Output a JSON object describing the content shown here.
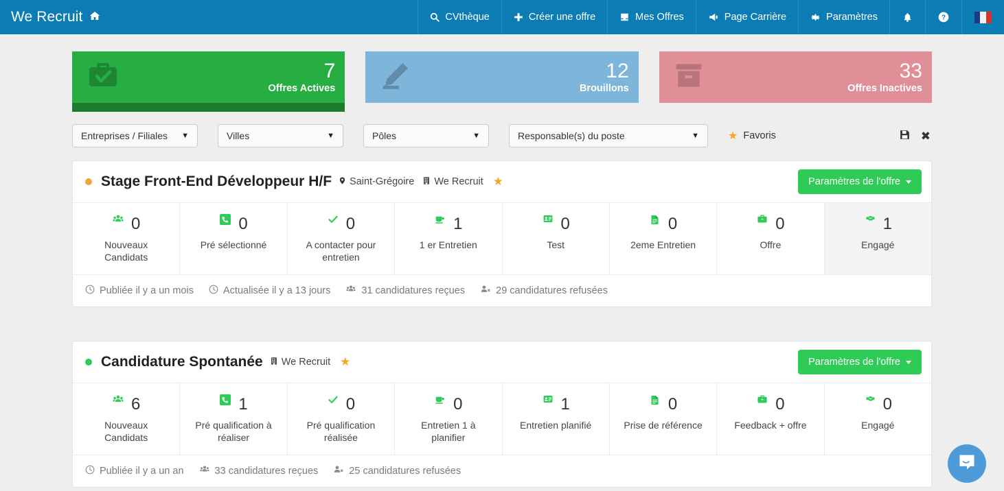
{
  "navbar": {
    "brand": "We Recruit",
    "brand_icon": "home-icon",
    "items": [
      {
        "label": "CVthèque",
        "icon": "search-icon"
      },
      {
        "label": "Créer une offre",
        "icon": "plus-icon"
      },
      {
        "label": "Mes Offres",
        "icon": "inbox-icon"
      },
      {
        "label": "Page Carrière",
        "icon": "bullhorn-icon"
      },
      {
        "label": "Paramètres",
        "icon": "gear-icon"
      }
    ],
    "notifications_icon": "bell-icon",
    "help_icon": "question-circle-icon",
    "language_icon": "french-flag-icon",
    "background": "#0c7cb5"
  },
  "stat_cards": [
    {
      "value": "7",
      "label": "Offres Actives",
      "icon": "briefcase-check-icon",
      "color": "#27ae43"
    },
    {
      "value": "12",
      "label": "Brouillons",
      "icon": "pencil-icon",
      "color": "#7eb5db"
    },
    {
      "value": "33",
      "label": "Offres Inactives",
      "icon": "archive-icon",
      "color": "#e08f96"
    }
  ],
  "filters": {
    "selects": [
      {
        "label": "Entreprises / Filiales",
        "width": "sel-w1"
      },
      {
        "label": "Villes",
        "width": "sel-w2"
      },
      {
        "label": "Pôles",
        "width": "sel-w3"
      },
      {
        "label": "Responsable(s) du poste",
        "width": "sel-w4"
      }
    ],
    "favoris_label": "Favoris",
    "favoris_icon": "star-icon",
    "save_icon": "floppy-disk-icon",
    "clear_icon": "close-x-icon"
  },
  "offers": [
    {
      "status_color": "orange",
      "title": "Stage Front-End Développeur H/F",
      "location": "Saint-Grégoire",
      "location_icon": "map-marker-icon",
      "company": "We Recruit",
      "company_icon": "building-icon",
      "favorite_icon": "star-icon",
      "button_label": "Paramètres de l'offre",
      "stages": [
        {
          "value": "0",
          "label": "Nouveaux Candidats",
          "icon": "users-icon",
          "highlight": false
        },
        {
          "value": "0",
          "label": "Pré sélectionné",
          "icon": "phone-icon",
          "highlight": false
        },
        {
          "value": "0",
          "label": "A contacter pour entretien",
          "icon": "check-icon",
          "highlight": false
        },
        {
          "value": "1",
          "label": "1 er Entretien",
          "icon": "coffee-icon",
          "highlight": false
        },
        {
          "value": "0",
          "label": "Test",
          "icon": "id-card-icon",
          "highlight": false
        },
        {
          "value": "0",
          "label": "2eme Entretien",
          "icon": "file-text-icon",
          "highlight": false
        },
        {
          "value": "0",
          "label": "Offre",
          "icon": "briefcase-icon",
          "highlight": false
        },
        {
          "value": "1",
          "label": "Engagé",
          "icon": "handshake-icon",
          "highlight": true
        }
      ],
      "footer": [
        {
          "text": "Publiée il y a un mois",
          "icon": "clock-icon"
        },
        {
          "text": "Actualisée il y a 13 jours",
          "icon": "clock-icon"
        },
        {
          "text": "31 candidatures reçues",
          "icon": "users-icon"
        },
        {
          "text": "29 candidatures refusées",
          "icon": "user-times-icon"
        }
      ]
    },
    {
      "status_color": "green",
      "title": "Candidature Spontanée",
      "location": "",
      "location_icon": "",
      "company": "We Recruit",
      "company_icon": "building-icon",
      "favorite_icon": "star-icon",
      "button_label": "Paramètres de l'offre",
      "stages": [
        {
          "value": "6",
          "label": "Nouveaux Candidats",
          "icon": "users-icon",
          "highlight": false
        },
        {
          "value": "1",
          "label": "Pré qualification à réaliser",
          "icon": "phone-icon",
          "highlight": false
        },
        {
          "value": "0",
          "label": "Pré qualification réalisée",
          "icon": "check-icon",
          "highlight": false
        },
        {
          "value": "0",
          "label": "Entretien 1 à planifier",
          "icon": "coffee-icon",
          "highlight": false
        },
        {
          "value": "1",
          "label": "Entretien planifié",
          "icon": "id-card-icon",
          "highlight": false
        },
        {
          "value": "0",
          "label": "Prise de référence",
          "icon": "file-text-icon",
          "highlight": false
        },
        {
          "value": "0",
          "label": "Feedback + offre",
          "icon": "briefcase-icon",
          "highlight": false
        },
        {
          "value": "0",
          "label": "Engagé",
          "icon": "handshake-icon",
          "highlight": false
        }
      ],
      "footer": [
        {
          "text": "Publiée il y a un an",
          "icon": "clock-icon"
        },
        {
          "text": "33 candidatures reçues",
          "icon": "users-icon"
        },
        {
          "text": "25 candidatures refusées",
          "icon": "user-times-icon"
        }
      ]
    }
  ],
  "chat": {
    "icon": "chat-bubble-icon",
    "color": "#4f9ad8"
  }
}
